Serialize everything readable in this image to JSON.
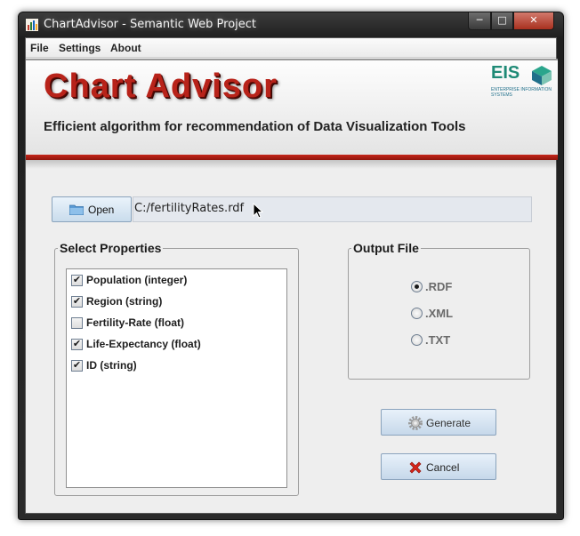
{
  "window": {
    "title": "ChartAdvisor - Semantic Web Project"
  },
  "menubar": {
    "items": [
      "File",
      "Settings",
      "About"
    ]
  },
  "banner": {
    "title": "Chart Advisor",
    "subtitle": "Efficient algorithm for recommendation of Data Visualization Tools",
    "logo": {
      "text": "EIS",
      "subtext": "ENTERPRISE INFORMATION SYSTEMS"
    }
  },
  "file": {
    "open_label": "Open",
    "path": "C:/fertilityRates.rdf"
  },
  "properties": {
    "title": "Select Properties",
    "items": [
      {
        "label": "Population  (integer)",
        "checked": true
      },
      {
        "label": "Region  (string)",
        "checked": true
      },
      {
        "label": "Fertility-Rate  (float)",
        "checked": false
      },
      {
        "label": "Life-Expectancy  (float)",
        "checked": true
      },
      {
        "label": "ID  (string)",
        "checked": true
      }
    ]
  },
  "output": {
    "title": "Output File",
    "options": [
      {
        "label": ".RDF",
        "selected": true
      },
      {
        "label": ".XML",
        "selected": false
      },
      {
        "label": ".TXT",
        "selected": false
      }
    ]
  },
  "actions": {
    "generate_label": "Generate",
    "cancel_label": "Cancel"
  },
  "colors": {
    "brand_red": "#b8231a",
    "eis_green": "#1f8a76",
    "button_blue": "#c6d8ea"
  }
}
